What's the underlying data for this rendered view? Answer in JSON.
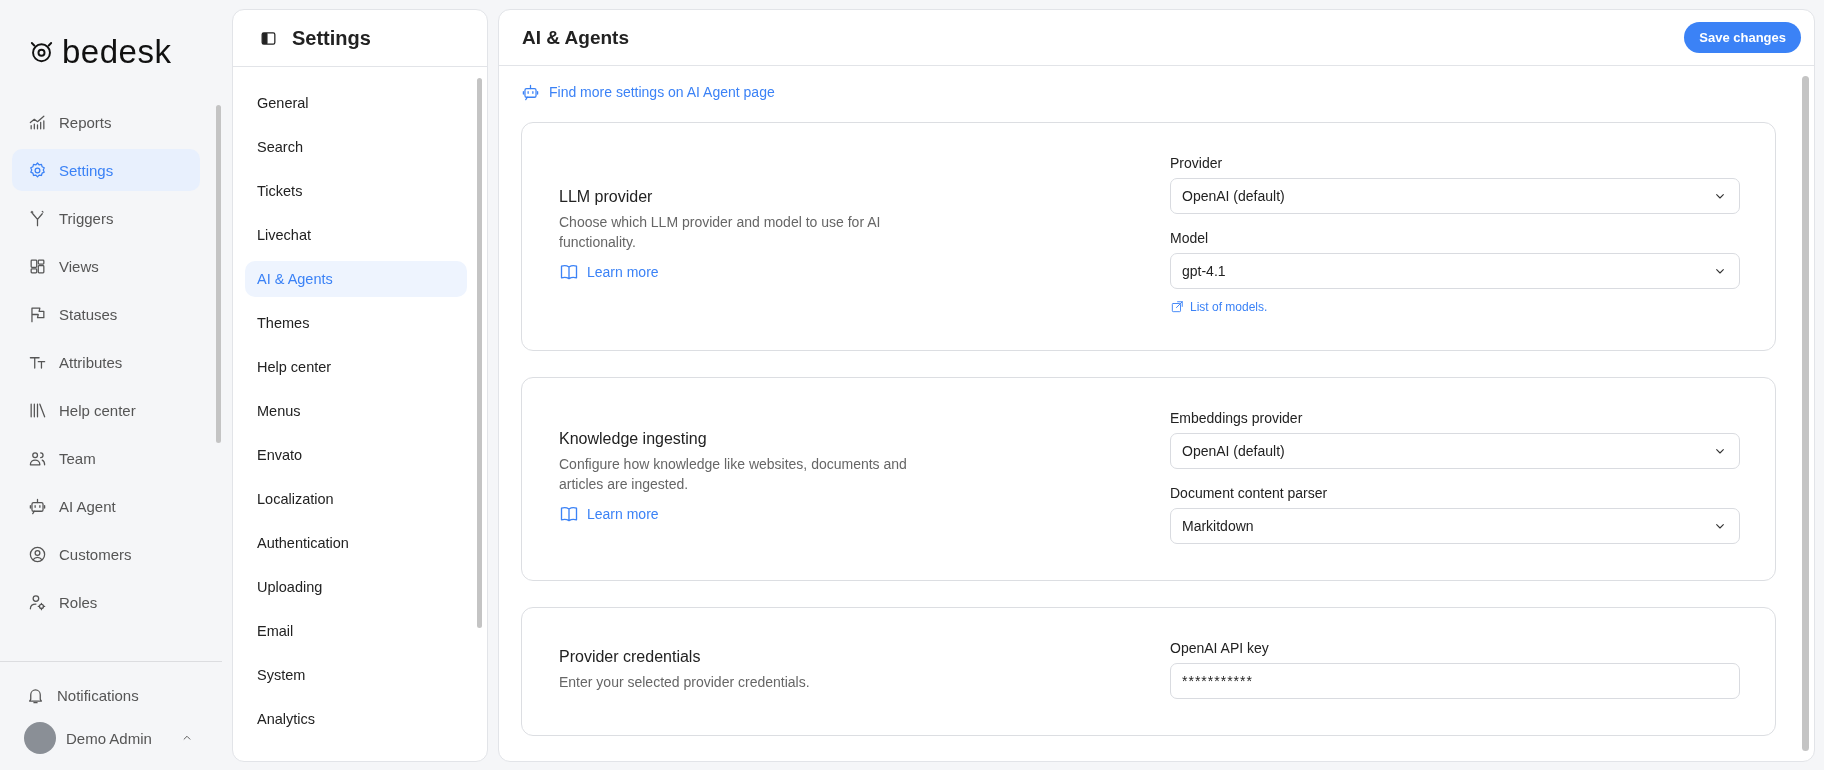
{
  "brand": {
    "name": "bedesk"
  },
  "sidebar": {
    "items": [
      {
        "label": "Reports",
        "selected": false
      },
      {
        "label": "Settings",
        "selected": true
      },
      {
        "label": "Triggers",
        "selected": false
      },
      {
        "label": "Views",
        "selected": false
      },
      {
        "label": "Statuses",
        "selected": false
      },
      {
        "label": "Attributes",
        "selected": false
      },
      {
        "label": "Help center",
        "selected": false
      },
      {
        "label": "Team",
        "selected": false
      },
      {
        "label": "AI Agent",
        "selected": false
      },
      {
        "label": "Customers",
        "selected": false
      },
      {
        "label": "Roles",
        "selected": false
      }
    ],
    "notifications": {
      "label": "Notifications"
    },
    "user": {
      "name": "Demo Admin"
    }
  },
  "settings_nav": {
    "title": "Settings",
    "items": [
      {
        "label": "General",
        "selected": false
      },
      {
        "label": "Search",
        "selected": false
      },
      {
        "label": "Tickets",
        "selected": false
      },
      {
        "label": "Livechat",
        "selected": false
      },
      {
        "label": "AI & Agents",
        "selected": true
      },
      {
        "label": "Themes",
        "selected": false
      },
      {
        "label": "Help center",
        "selected": false
      },
      {
        "label": "Menus",
        "selected": false
      },
      {
        "label": "Envato",
        "selected": false
      },
      {
        "label": "Localization",
        "selected": false
      },
      {
        "label": "Authentication",
        "selected": false
      },
      {
        "label": "Uploading",
        "selected": false
      },
      {
        "label": "Email",
        "selected": false
      },
      {
        "label": "System",
        "selected": false
      },
      {
        "label": "Analytics",
        "selected": false
      }
    ]
  },
  "main": {
    "title": "AI & Agents",
    "save_button": "Save changes",
    "top_link": "Find more settings on AI Agent page",
    "sections": [
      {
        "title": "LLM provider",
        "description": "Choose which LLM provider and model to use for AI functionality.",
        "link": "Learn more",
        "fields": [
          {
            "kind": "select",
            "label": "Provider",
            "value": "OpenAI (default)"
          },
          {
            "kind": "select",
            "label": "Model",
            "value": "gpt-4.1",
            "help_link": "List of models."
          }
        ]
      },
      {
        "title": "Knowledge ingesting",
        "description": "Configure how knowledge like websites, documents and articles are ingested.",
        "link": "Learn more",
        "fields": [
          {
            "kind": "select",
            "label": "Embeddings provider",
            "value": "OpenAI (default)"
          },
          {
            "kind": "select",
            "label": "Document content parser",
            "value": "Markitdown"
          }
        ]
      },
      {
        "title": "Provider credentials",
        "description": "Enter your selected provider credentials.",
        "fields": [
          {
            "kind": "password",
            "label": "OpenAI API key",
            "value": "***********"
          }
        ]
      }
    ]
  }
}
